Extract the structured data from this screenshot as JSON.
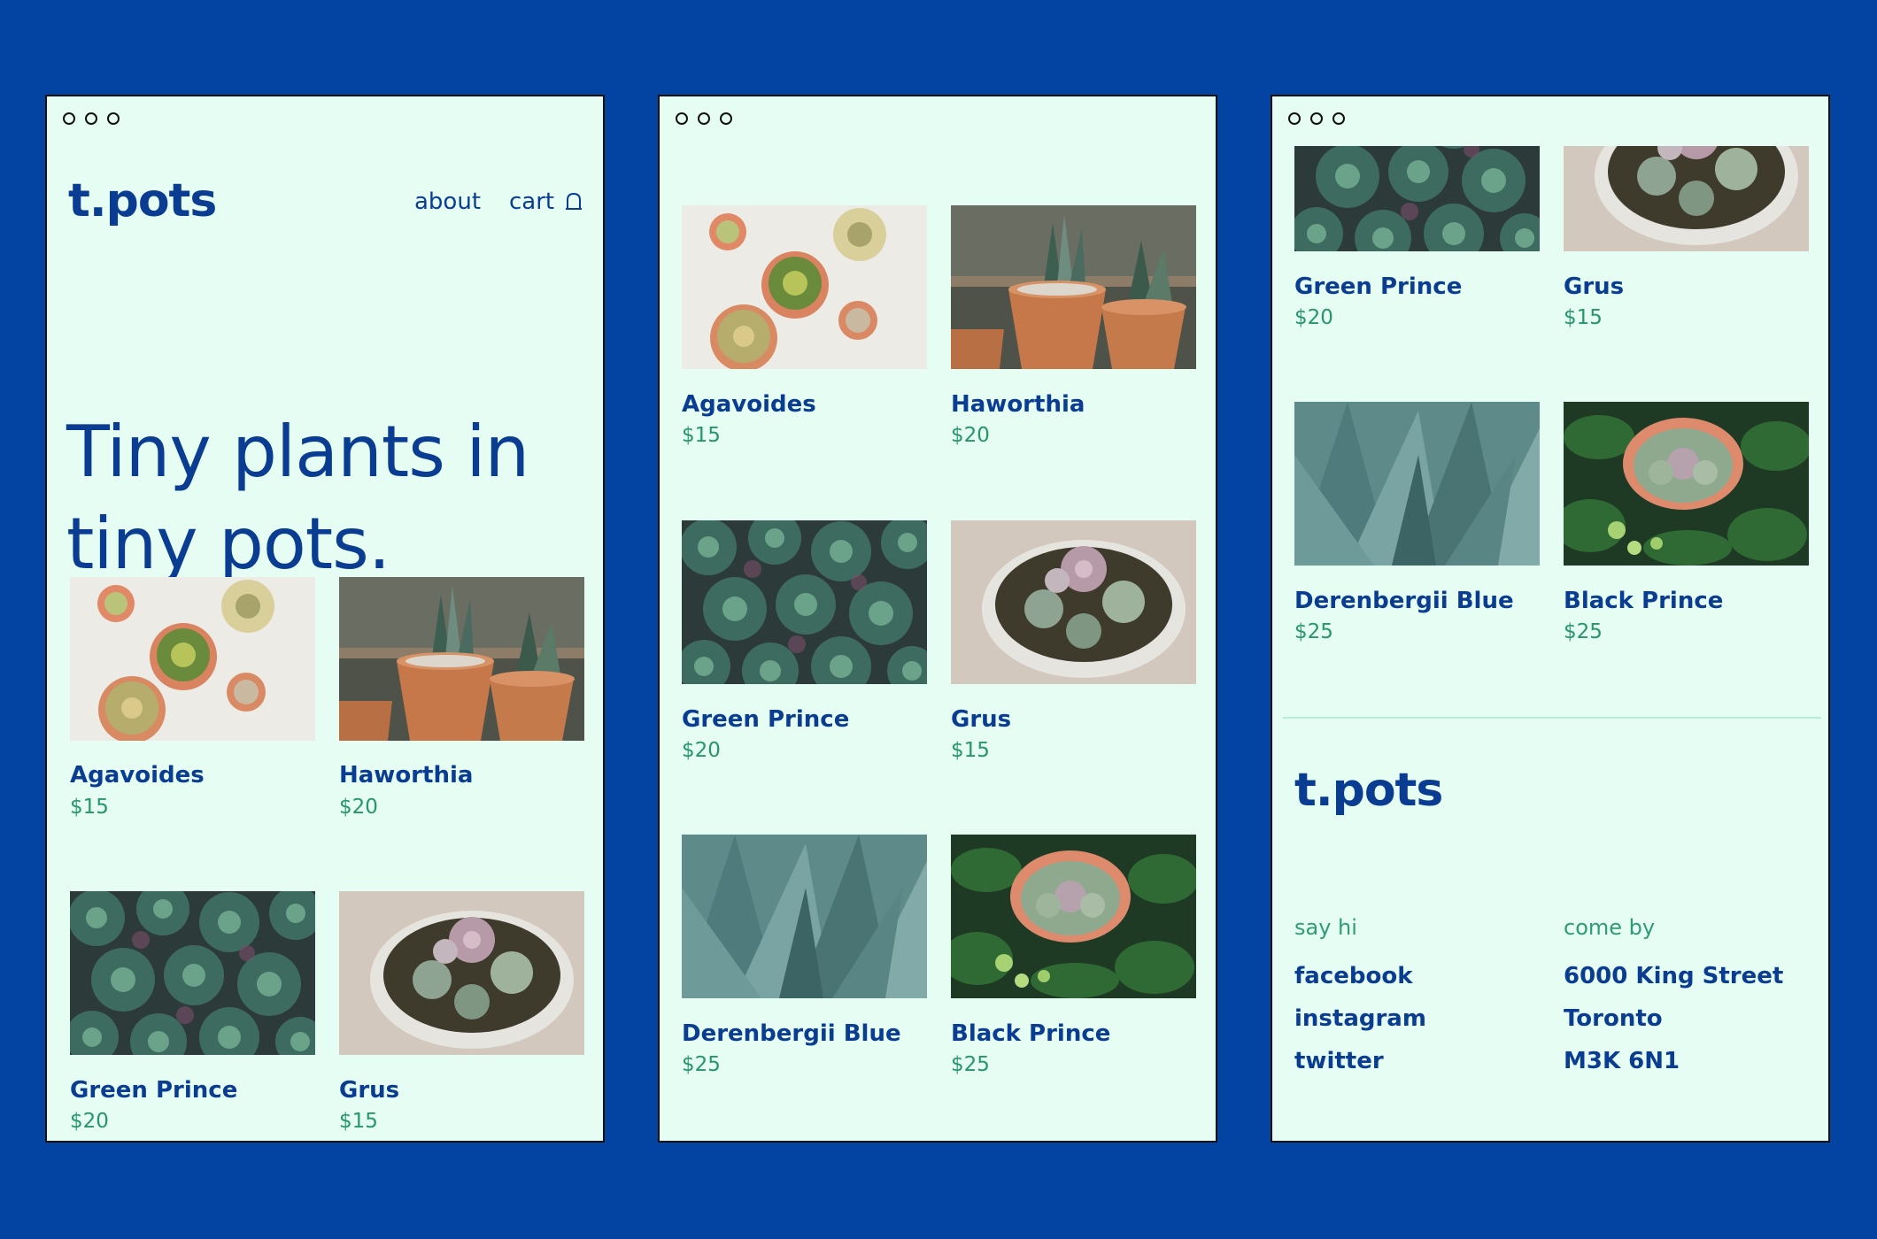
{
  "brand": {
    "logo": "t.pots"
  },
  "nav": {
    "about": "about",
    "cart": "cart",
    "cart_icon": "bag-icon"
  },
  "hero": {
    "line1": "Tiny plants in",
    "line2": "tiny pots."
  },
  "products": [
    {
      "name": "Agavoides",
      "price": "$15",
      "image": "agavoides-photo"
    },
    {
      "name": "Haworthia",
      "price": "$20",
      "image": "haworthia-photo"
    },
    {
      "name": "Green Prince",
      "price": "$20",
      "image": "green-prince-photo"
    },
    {
      "name": "Grus",
      "price": "$15",
      "image": "grus-photo"
    },
    {
      "name": "Derenbergii Blue",
      "price": "$25",
      "image": "derenbergii-blue-photo"
    },
    {
      "name": "Black Prince",
      "price": "$25",
      "image": "black-prince-photo"
    }
  ],
  "footer": {
    "logo": "t.pots",
    "say_hi": {
      "heading": "say hi",
      "links": [
        "facebook",
        "instagram",
        "twitter"
      ]
    },
    "come_by": {
      "heading": "come by",
      "lines": [
        "6000 King Street",
        "Toronto",
        "M3K 6N1"
      ]
    }
  },
  "colors": {
    "background": "#0344a2",
    "window": "#e6fdf3",
    "brand_blue": "#0a3d92",
    "price_green": "#27966a"
  }
}
